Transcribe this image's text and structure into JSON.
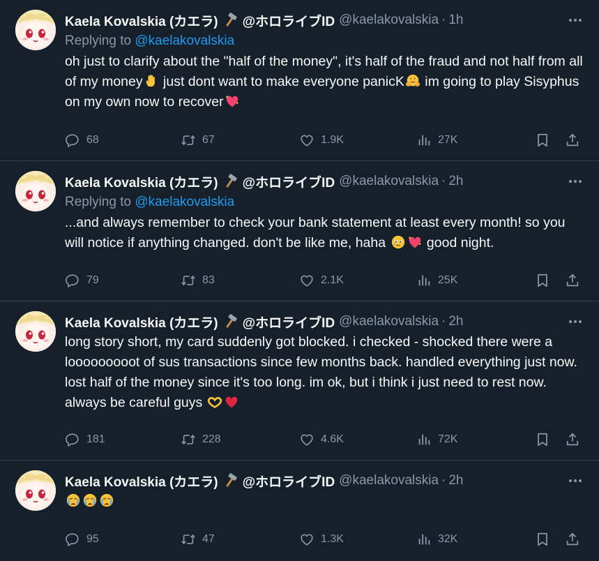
{
  "colors": {
    "background": "#15202b",
    "accent": "#1d9bf0",
    "muted": "#8b98a5",
    "divider": "#38444d"
  },
  "author": {
    "name": "Kaela Kovalskia (カエラ)",
    "affiliation": "@ホロライブID",
    "handle": "@kaelakovalskia",
    "name_icon": "hammer-icon"
  },
  "labels": {
    "dot": "·",
    "replying_to": "Replying to"
  },
  "tweets": [
    {
      "time": "1h",
      "replying_to": "@kaelakovalskia",
      "text_parts": [
        "oh just to clarify about the \"half of the money\", it's half of the fraud and not half from all of my money",
        " just dont want to make everyone panicK",
        " im going to play Sisyphus on my own now to recover"
      ],
      "emojis": [
        "raised-hand-emoji",
        "hugging-face-emoji",
        "sparkling-heart-emoji"
      ],
      "stats": {
        "replies": "68",
        "retweets": "67",
        "likes": "1.9K",
        "views": "27K"
      }
    },
    {
      "time": "2h",
      "replying_to": "@kaelakovalskia",
      "text_parts": [
        "...and always remember to check your bank statement at least every month! so you will notice if anything changed. don't be like me, haha ",
        "",
        " good night."
      ],
      "emojis": [
        "teary-smile-emoji",
        "sparkling-heart-emoji"
      ],
      "stats": {
        "replies": "79",
        "retweets": "83",
        "likes": "2.1K",
        "views": "25K"
      }
    },
    {
      "time": "2h",
      "text_parts": [
        "long story short, my card suddenly got blocked. i checked - shocked there were a looooooooot of sus transactions since few months back. handled everything just now. lost half of the money since it's too long. im ok, but i think i just need to rest now. always be careful guys "
      ],
      "emojis": [
        "heart-hands-emoji",
        "red-heart-emoji"
      ],
      "stats": {
        "replies": "181",
        "retweets": "228",
        "likes": "4.6K",
        "views": "72K"
      }
    },
    {
      "time": "2h",
      "text_parts": [],
      "emojis": [
        "crying-face-emoji",
        "crying-face-emoji",
        "crying-face-emoji"
      ],
      "stats": {
        "replies": "95",
        "retweets": "47",
        "likes": "1.3K",
        "views": "32K"
      }
    }
  ]
}
